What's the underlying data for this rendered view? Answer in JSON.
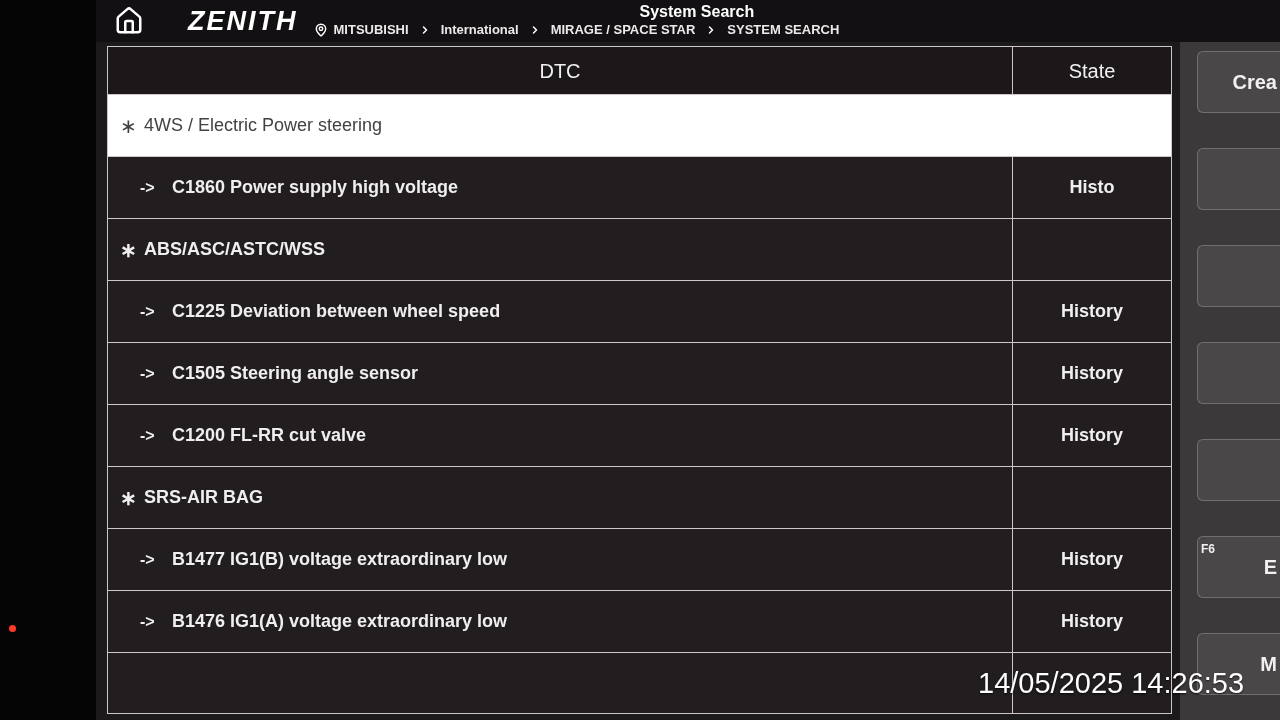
{
  "header": {
    "logo": "ZENITH",
    "title": "System Search",
    "breadcrumb": [
      "MITSUBISHI",
      "International",
      "MIRAGE / SPACE STAR",
      "SYSTEM SEARCH"
    ]
  },
  "table": {
    "columns": [
      "DTC",
      "State"
    ],
    "rows": [
      {
        "kind": "group",
        "marker": "∗",
        "label": "4WS / Electric Power steering",
        "selected": true
      },
      {
        "kind": "code",
        "marker": "->",
        "label": "C1860 Power supply high voltage",
        "state": "Histo",
        "selected": false
      },
      {
        "kind": "group",
        "marker": "∗",
        "label": "ABS/ASC/ASTC/WSS",
        "selected": false
      },
      {
        "kind": "code",
        "marker": "->",
        "label": "C1225 Deviation between wheel speed",
        "state": "History",
        "selected": false
      },
      {
        "kind": "code",
        "marker": "->",
        "label": "C1505 Steering angle sensor",
        "state": "History",
        "selected": false
      },
      {
        "kind": "code",
        "marker": "->",
        "label": "C1200 FL-RR cut valve",
        "state": "History",
        "selected": false
      },
      {
        "kind": "group",
        "marker": "∗",
        "label": "SRS-AIR BAG",
        "selected": false
      },
      {
        "kind": "code",
        "marker": "->",
        "label": "B1477 IG1(B) voltage extraordinary low",
        "state": "History",
        "selected": false
      },
      {
        "kind": "code",
        "marker": "->",
        "label": "B1476 IG1(A) voltage extraordinary low",
        "state": "History",
        "selected": false
      }
    ]
  },
  "side_buttons": [
    {
      "kind": "labeled",
      "label": "Crea"
    },
    {
      "kind": "blank"
    },
    {
      "kind": "blank"
    },
    {
      "kind": "blank"
    },
    {
      "kind": "blank"
    },
    {
      "kind": "labeled",
      "key": "F6",
      "label": "E"
    },
    {
      "kind": "labeled",
      "label": "M"
    }
  ],
  "photo_timestamp": "14/05/2025 14:26:53"
}
